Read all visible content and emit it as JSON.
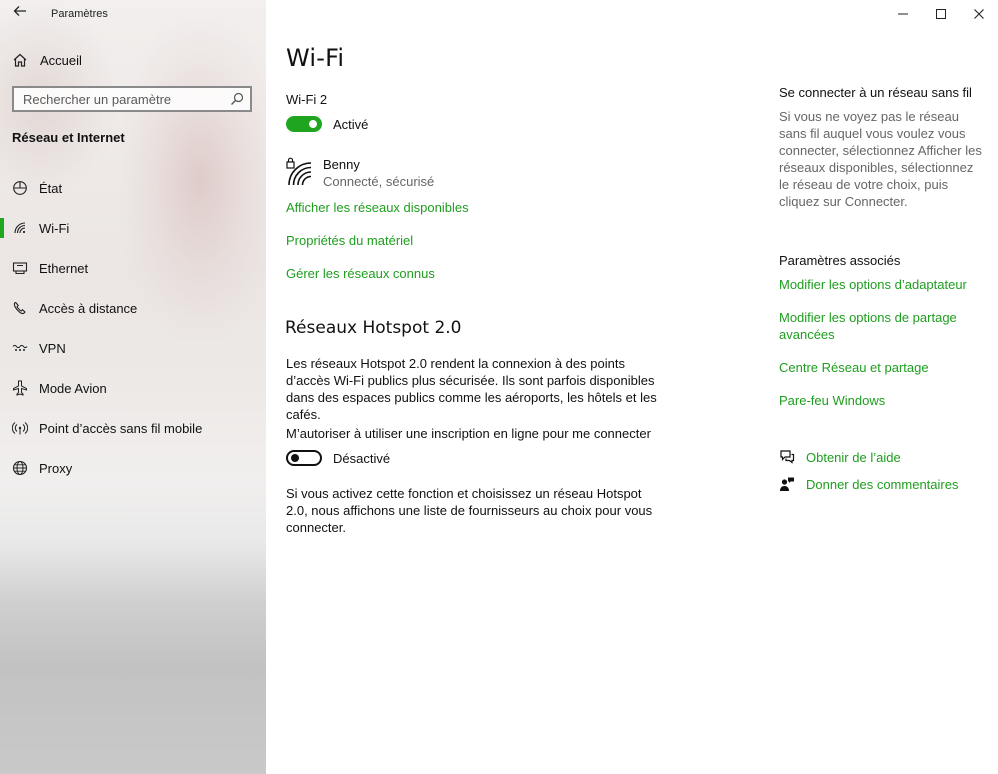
{
  "window": {
    "title": "Paramètres",
    "controls": {
      "minimize": "—",
      "maximize": "☐",
      "close": "✕"
    }
  },
  "sidebar": {
    "home_label": "Accueil",
    "search_placeholder": "Rechercher un paramètre",
    "section_title": "Réseau et Internet",
    "items": [
      {
        "label": "État",
        "icon": "status-icon",
        "active": false
      },
      {
        "label": "Wi-Fi",
        "icon": "wifi-icon",
        "active": true
      },
      {
        "label": "Ethernet",
        "icon": "ethernet-icon",
        "active": false
      },
      {
        "label": "Accès à distance",
        "icon": "dial-up-icon",
        "active": false
      },
      {
        "label": "VPN",
        "icon": "vpn-icon",
        "active": false
      },
      {
        "label": "Mode Avion",
        "icon": "airplane-icon",
        "active": false
      },
      {
        "label": "Point d’accès sans fil mobile",
        "icon": "hotspot-icon",
        "active": false
      },
      {
        "label": "Proxy",
        "icon": "globe-icon",
        "active": false
      }
    ]
  },
  "main": {
    "title": "Wi-Fi",
    "adapter_name": "Wi-Fi 2",
    "wifi_toggle": {
      "state": "on",
      "label": "Activé"
    },
    "network": {
      "name": "Benny",
      "status": "Connecté, sécurisé"
    },
    "links": {
      "show_networks": "Afficher les réseaux disponibles",
      "hardware_properties": "Propriétés du matériel",
      "manage_known": "Gérer les réseaux connus"
    },
    "hotspot": {
      "title": "Réseaux Hotspot 2.0",
      "description": "Les réseaux Hotspot 2.0 rendent la connexion à des points d’accès Wi-Fi publics plus sécurisée. Ils sont parfois disponibles dans des espaces publics comme les aéroports, les hôtels et les cafés.",
      "option_label": "M’autoriser à utiliser une inscription en ligne pour me connecter",
      "toggle": {
        "state": "off",
        "label": "Désactivé"
      },
      "note": "Si vous activez cette fonction et choisissez un réseau Hotspot 2.0, nous affichons une liste de fournisseurs au choix pour vous connecter."
    }
  },
  "right": {
    "connect_title": "Se connecter à un réseau sans fil",
    "connect_text": "Si vous ne voyez pas le réseau sans fil auquel vous voulez vous connecter, sélectionnez Afficher les réseaux disponibles, sélectionnez le réseau de votre choix, puis cliquez sur Connecter.",
    "related_title": "Paramètres associés",
    "related_links": [
      "Modifier les options d’adaptateur",
      "Modifier les options de partage avancées",
      "Centre Réseau et partage",
      "Pare-feu Windows"
    ],
    "help_label": "Obtenir de l’aide",
    "feedback_label": "Donner des commentaires"
  },
  "colors": {
    "accent": "#1e9e1e",
    "secondary_text": "#666666"
  }
}
